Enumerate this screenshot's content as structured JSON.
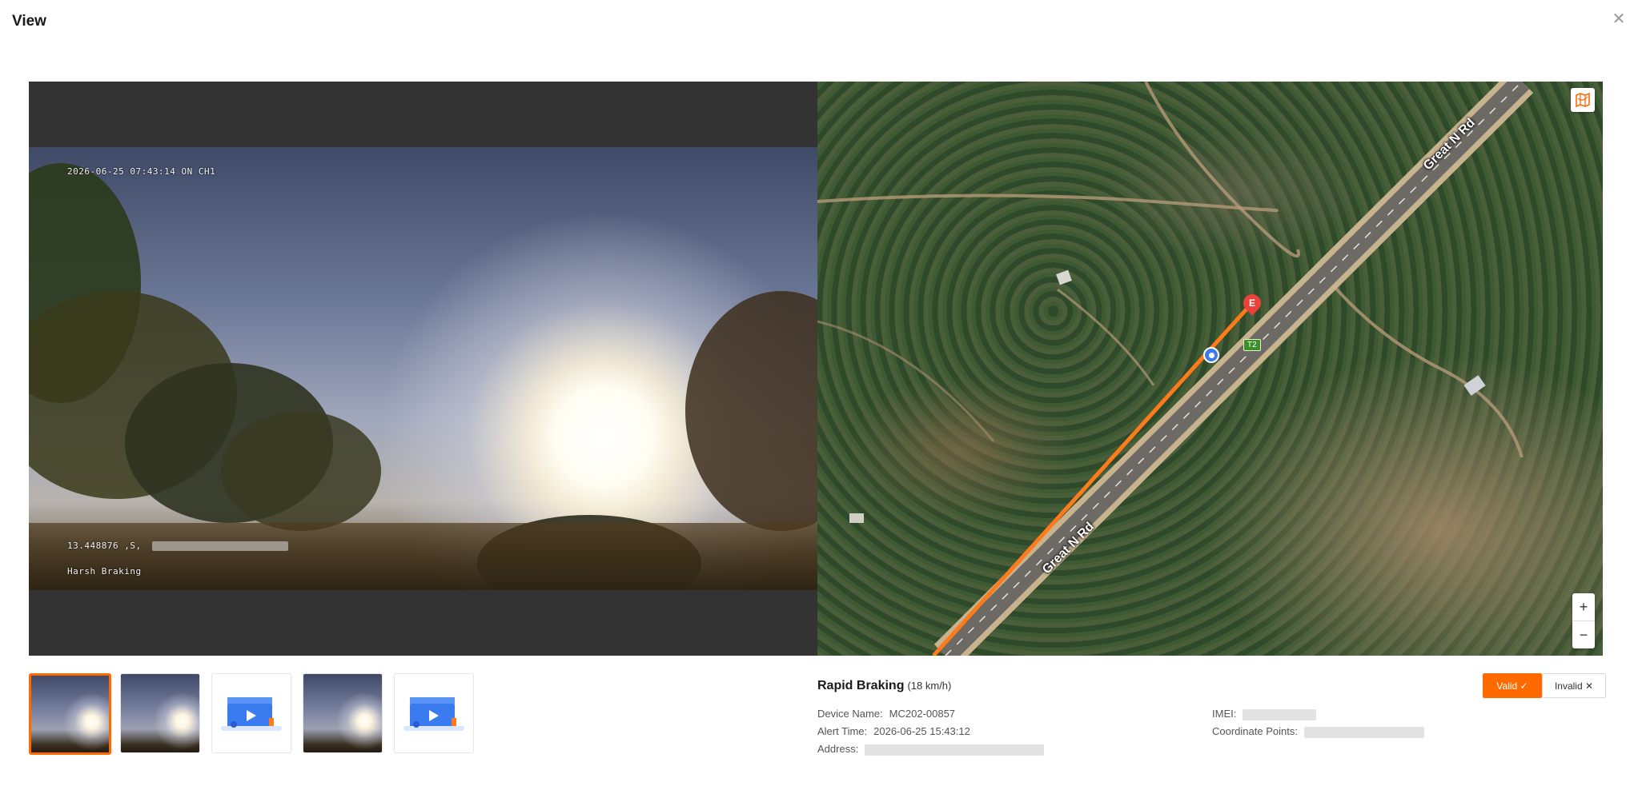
{
  "modal": {
    "title": "View",
    "close_icon": "close-icon"
  },
  "video": {
    "osd_top": "2026-06-25 07:43:14 ON  CH1",
    "osd_coord": "13.448876  ,S,",
    "osd_event": "Harsh Braking"
  },
  "map": {
    "road_label_top": "Great N Rd",
    "road_label_bottom": "Great N Rd",
    "end_marker": "E",
    "vehicle_tag": "T2",
    "route_color": "#ff7a1a",
    "map_type_icon": "map-layer-icon",
    "zoom_in": "+",
    "zoom_out": "−"
  },
  "thumbnails": [
    {
      "kind": "photo",
      "active": true
    },
    {
      "kind": "photo",
      "active": false
    },
    {
      "kind": "video",
      "active": false
    },
    {
      "kind": "photo",
      "active": false
    },
    {
      "kind": "video",
      "active": false
    }
  ],
  "alert": {
    "title": "Rapid Braking",
    "speed": "(18 km/h)",
    "device_label": "Device Name:",
    "device_value": "MC202-00857",
    "time_label": "Alert Time:",
    "time_value": "2026-06-25 15:43:12",
    "address_label": "Address:",
    "imei_label": "IMEI:",
    "coord_label": "Coordinate Points:"
  },
  "actions": {
    "valid_label": "Valid ✓",
    "invalid_label": "Invalid ✕"
  },
  "colors": {
    "accent": "#ff6a00",
    "marker_start": "#3b7bea",
    "marker_end": "#e8423a"
  }
}
